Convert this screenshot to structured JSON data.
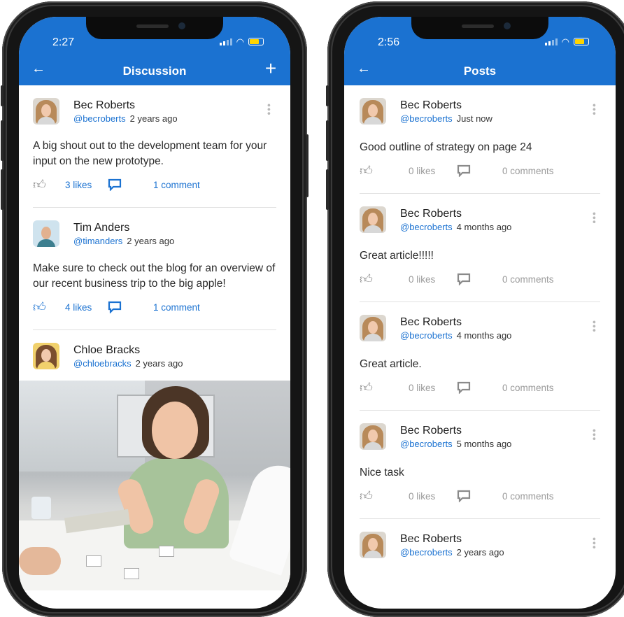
{
  "left_phone": {
    "status": {
      "time": "2:27"
    },
    "appbar": {
      "title": "Discussion",
      "back": "←",
      "add": "+"
    },
    "posts": [
      {
        "name": "Bec Roberts",
        "handle": "@becroberts",
        "time": "2 years ago",
        "text": "A big shout out to the development team for your input on the new prototype.",
        "likes": "3 likes",
        "comments": "1 comment",
        "liked": false
      },
      {
        "name": "Tim Anders",
        "handle": "@timanders",
        "time": "2 years ago",
        "text": "Make sure to check out the blog for an overview of our recent business trip to the big apple!",
        "likes": "4 likes",
        "comments": "1 comment",
        "liked": true
      },
      {
        "name": "Chloe Bracks",
        "handle": "@chloebracks",
        "time": "2 years ago"
      }
    ]
  },
  "right_phone": {
    "status": {
      "time": "2:56"
    },
    "appbar": {
      "title": "Posts",
      "back": "←"
    },
    "posts": [
      {
        "name": "Bec Roberts",
        "handle": "@becroberts",
        "time": "Just now",
        "text": "Good outline of strategy on page 24",
        "likes": "0 likes",
        "comments": "0 comments"
      },
      {
        "name": "Bec Roberts",
        "handle": "@becroberts",
        "time": "4 months ago",
        "text": "Great article!!!!!",
        "likes": "0 likes",
        "comments": "0 comments"
      },
      {
        "name": "Bec Roberts",
        "handle": "@becroberts",
        "time": "4 months ago",
        "text": "Great article.",
        "likes": "0 likes",
        "comments": "0 comments"
      },
      {
        "name": "Bec Roberts",
        "handle": "@becroberts",
        "time": "5 months ago",
        "text": "Nice task",
        "likes": "0 likes",
        "comments": "0 comments"
      },
      {
        "name": "Bec Roberts",
        "handle": "@becroberts",
        "time": "2 years ago"
      }
    ]
  },
  "icons": {
    "like": "thumbs-up-icon",
    "comment": "comment-icon",
    "more": "more-vertical-icon",
    "back": "arrow-left-icon",
    "add": "plus-icon"
  },
  "colors": {
    "brand": "#1b72d1",
    "muted": "#9a9a9a",
    "avatar_hair_bec": "#b88a5a",
    "avatar_hair_chloe": "#7a4e2e",
    "battery": "#ffd400"
  }
}
